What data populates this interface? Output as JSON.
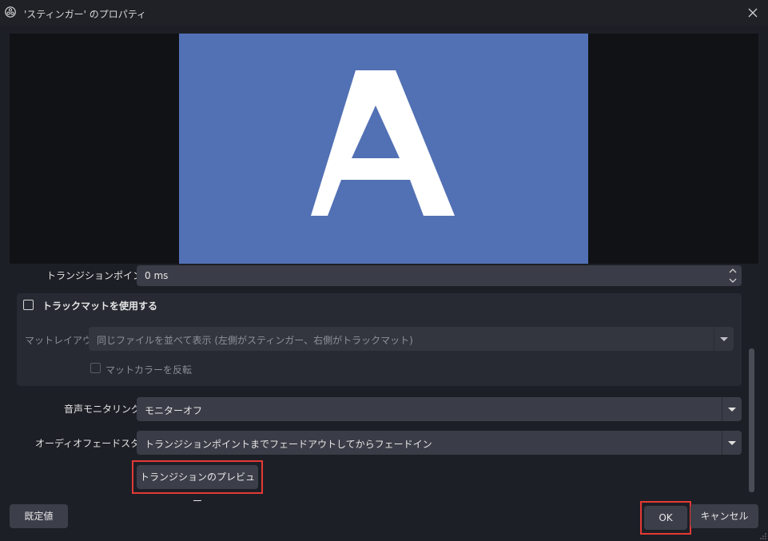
{
  "window": {
    "title": "'スティンガー' のプロパティ"
  },
  "preview": {
    "letter": "A",
    "bg_color": "#5270b4"
  },
  "transition_point": {
    "label": "トランジションポイント",
    "value": "0 ms"
  },
  "track_matte": {
    "checkbox_label": "トラックマットを使用する",
    "layout_label": "マットレイアウト",
    "layout_value": "同じファイルを並べて表示 (左側がスティンガー、右側がトラックマット)",
    "invert_label": "マットカラーを反転"
  },
  "audio_monitoring": {
    "label": "音声モニタリング",
    "value": "モニターオフ"
  },
  "audio_fade": {
    "label": "オーディオフェードスタイル",
    "value": "トランジションポイントまでフェードアウトしてからフェードイン"
  },
  "buttons": {
    "preview": "トランジションのプレビュー",
    "defaults": "既定値",
    "ok": "OK",
    "cancel": "キャンセル"
  },
  "colors": {
    "highlight": "#e53935",
    "accent": "#5270b4"
  }
}
